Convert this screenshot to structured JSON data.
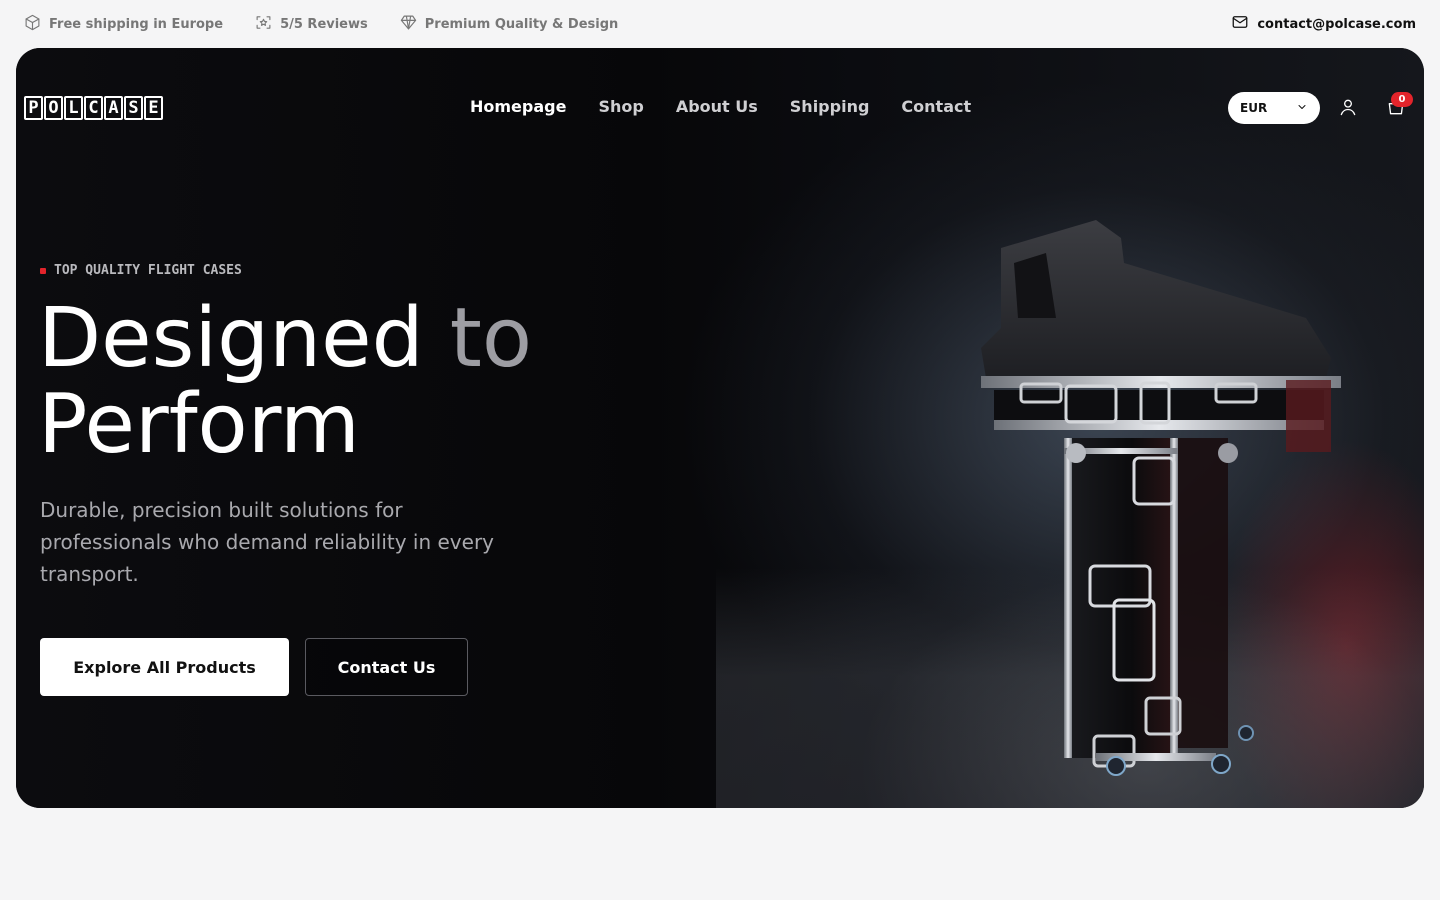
{
  "topbar": {
    "items": [
      {
        "icon": "box-icon",
        "label": "Free shipping in Europe"
      },
      {
        "icon": "star-frame-icon",
        "label": "5/5 Reviews"
      },
      {
        "icon": "diamond-icon",
        "label": "Premium Quality & Design"
      }
    ],
    "contact": {
      "icon": "mail-icon",
      "label": "contact@polcase.com"
    }
  },
  "nav": {
    "logo": [
      "P",
      "O",
      "L",
      "C",
      "A",
      "S",
      "E"
    ],
    "menu": [
      {
        "label": "Homepage",
        "active": true
      },
      {
        "label": "Shop",
        "active": false
      },
      {
        "label": "About Us",
        "active": false
      },
      {
        "label": "Shipping",
        "active": false
      },
      {
        "label": "Contact",
        "active": false
      }
    ],
    "currency": "EUR",
    "cart_count": "0"
  },
  "hero": {
    "eyebrow": "TOP QUALITY FLIGHT CASES",
    "headline_main": "Designed",
    "headline_fade": " to",
    "headline_line2": "Perform",
    "subtext": "Durable, precision built solutions for professionals who demand reliability in every transport.",
    "primary_button": "Explore All Products",
    "secondary_button": "Contact Us"
  },
  "colors": {
    "accent_red": "#e3242b",
    "hero_bg": "#0a0a0d",
    "page_bg": "#f5f5f6"
  }
}
